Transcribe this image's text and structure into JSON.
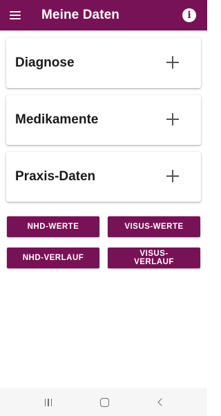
{
  "app_bar": {
    "title": "Meine Daten",
    "menu_icon": "hamburger-menu-icon",
    "info_icon": "info-circle-icon",
    "info_glyph": "i"
  },
  "cards": [
    {
      "label": "Diagnose",
      "icon": "plus-icon"
    },
    {
      "label": "Medikamente",
      "icon": "plus-icon"
    },
    {
      "label": "Praxis-Daten",
      "icon": "plus-icon"
    }
  ],
  "buttons": {
    "nhd_werte": "NHD-WERTE",
    "visus_werte": "VISUS-WERTE",
    "nhd_verlauf": "NHD-VERLAUF",
    "visus_verlauf": "VISUS-VERLAUF"
  },
  "nav_bar": {
    "recents_icon": "recent-apps-icon",
    "home_icon": "home-icon",
    "back_icon": "back-icon"
  },
  "colors": {
    "primary": "#781257",
    "app_bar_text": "#ffffff",
    "nav_bar_bg": "#f6f6f6"
  }
}
